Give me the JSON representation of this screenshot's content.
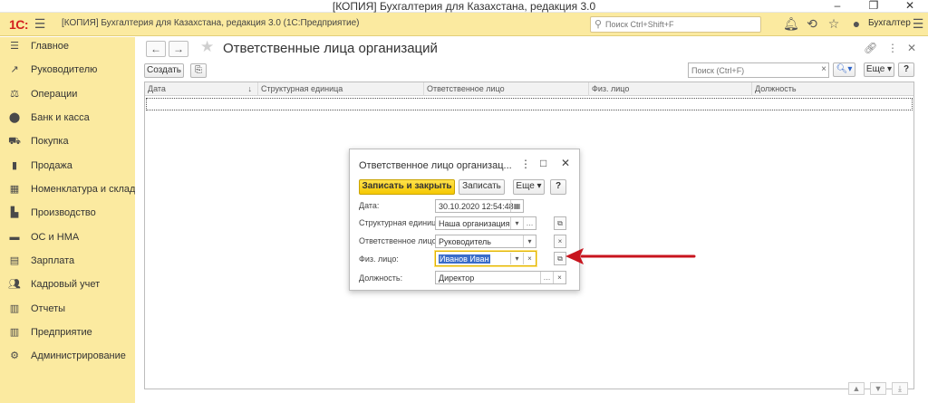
{
  "window": {
    "title": "[КОПИЯ] Бухгалтерия для Казахстана, редакция 3.0"
  },
  "app_toolbar": {
    "logo": "1С:",
    "title": "[КОПИЯ] Бухгалтерия для Казахстана, редакция 3.0  (1С:Предприятие)",
    "search_placeholder": "Поиск Ctrl+Shift+F",
    "user": "Бухгалтер"
  },
  "sidebar": {
    "items": [
      {
        "label": "Главное",
        "icon": "menu-icon"
      },
      {
        "label": "Руководителю",
        "icon": "trend-icon"
      },
      {
        "label": "Операции",
        "icon": "operations-icon"
      },
      {
        "label": "Банк и касса",
        "icon": "bank-icon"
      },
      {
        "label": "Покупка",
        "icon": "cart-icon"
      },
      {
        "label": "Продажа",
        "icon": "bag-icon"
      },
      {
        "label": "Номенклатура и склад",
        "icon": "warehouse-icon"
      },
      {
        "label": "Производство",
        "icon": "factory-icon"
      },
      {
        "label": "ОС и НМА",
        "icon": "truck-icon"
      },
      {
        "label": "Зарплата",
        "icon": "salary-icon"
      },
      {
        "label": "Кадровый учет",
        "icon": "people-icon"
      },
      {
        "label": "Отчеты",
        "icon": "reports-icon"
      },
      {
        "label": "Предприятие",
        "icon": "enterprise-icon"
      },
      {
        "label": "Администрирование",
        "icon": "gear-icon"
      }
    ]
  },
  "form": {
    "title": "Ответственные лица организаций",
    "create_label": "Создать",
    "search_placeholder": "Поиск (Ctrl+F)",
    "more_label": "Еще",
    "help_label": "?",
    "columns": [
      "Дата",
      "Структурная единица",
      "Ответственное лицо",
      "Физ. лицо",
      "Должность"
    ]
  },
  "dialog": {
    "title": "Ответственное лицо организац...",
    "save_close_label": "Записать и закрыть",
    "save_label": "Записать",
    "more_label": "Еще",
    "help_label": "?",
    "fields": {
      "date_label": "Дата:",
      "date_value": "30.10.2020 12:54:48",
      "unit_label": "Структурная единица:",
      "unit_value": "Наша организация",
      "person_label": "Ответственное лицо:",
      "person_value": "Руководитель",
      "individual_label": "Физ. лицо:",
      "individual_value": "Иванов Иван",
      "position_label": "Должность:",
      "position_value": "Директор"
    }
  },
  "colors": {
    "accent_yellow": "#fbeaa0",
    "primary_button": "#f5c800",
    "arrow": "#c8141e"
  }
}
